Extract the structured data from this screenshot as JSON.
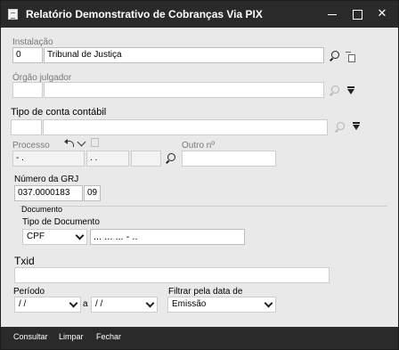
{
  "window": {
    "title": "Relatório Demonstrativo de Cobranças Via PIX"
  },
  "instalacao": {
    "label": "Instalação",
    "code": "0",
    "name": "Tribunal de Justiça"
  },
  "orgao_julgador": {
    "label": "Órgão julgador",
    "code": "",
    "name": ""
  },
  "tipo_conta": {
    "label": "Tipo de conta contábil",
    "code": "",
    "name": ""
  },
  "processo": {
    "label": "Processo",
    "part1": "  -   .",
    "part2": " .   .",
    "part3": "",
    "outro_label": "Outro nº",
    "outro_value": ""
  },
  "numero_grj": {
    "label": "Número da GRJ",
    "number": "037.0000183",
    "suffix": "09"
  },
  "documento": {
    "group_label": "Documento",
    "tipo_label": "Tipo de Documento",
    "tipo_value": "CPF",
    "number_mask": "... ... ... - .."
  },
  "txid": {
    "label": "Txid",
    "value": ""
  },
  "periodo": {
    "label": "Período",
    "from": " /  /",
    "separator": "a",
    "to": " /  /"
  },
  "filtrar": {
    "label": "Filtrar pela data de",
    "value": "Emissão"
  },
  "toolbar": {
    "consultar": "Consultar",
    "limpar": "Limpar",
    "fechar": "Fechar"
  }
}
